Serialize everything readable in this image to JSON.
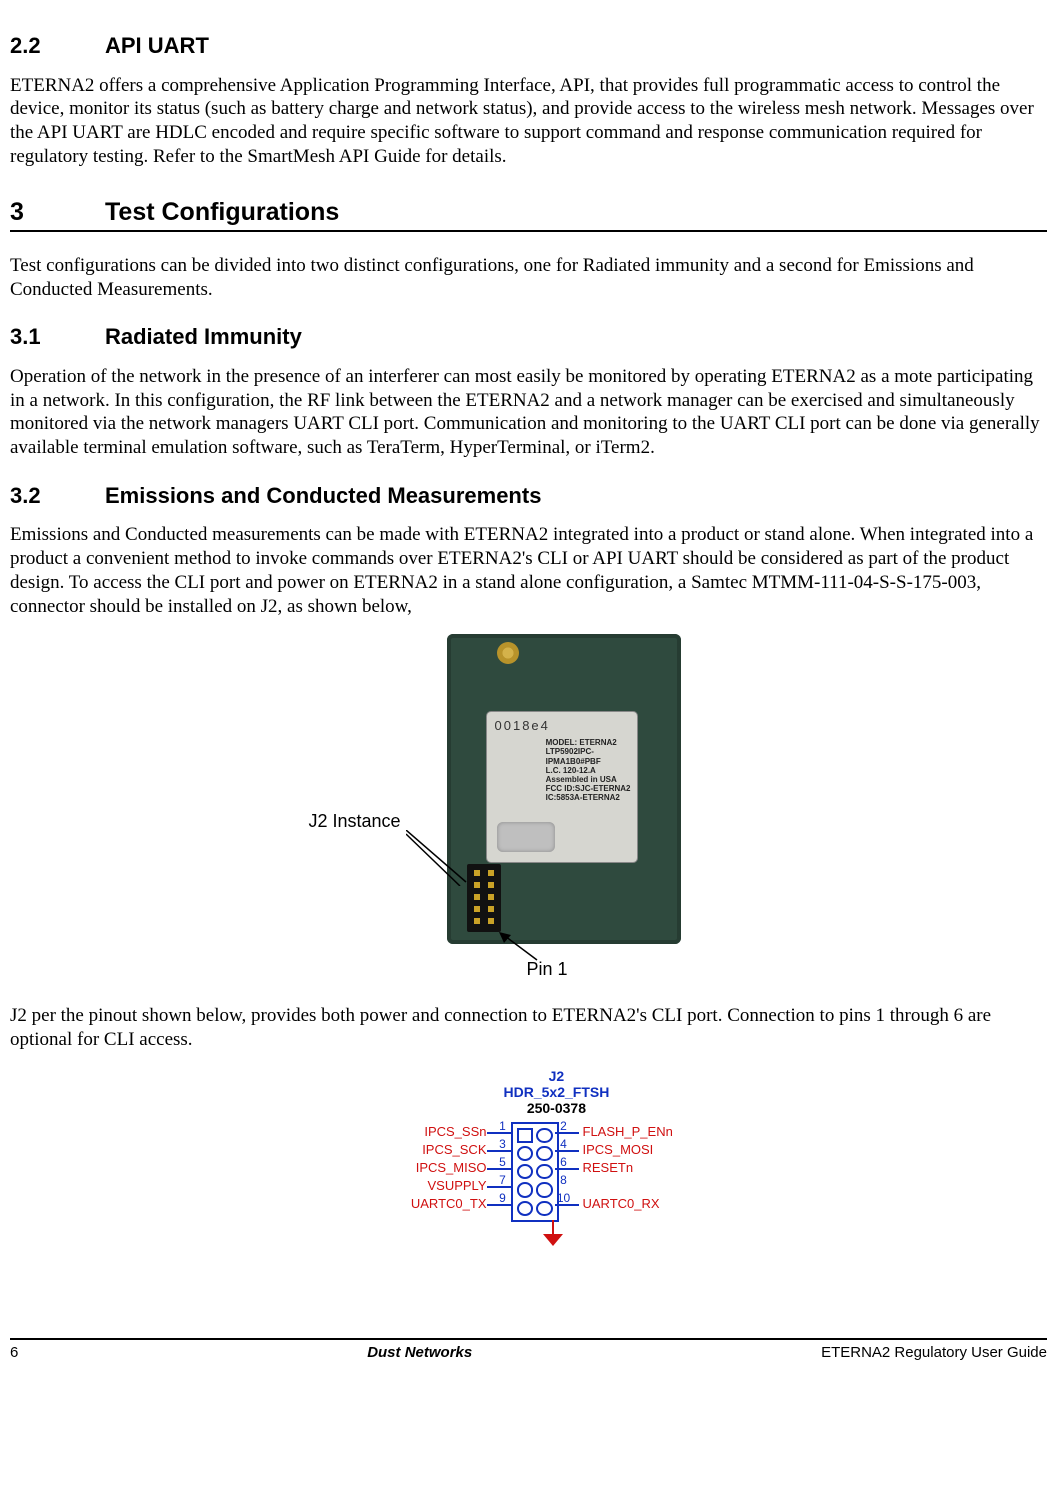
{
  "s22": {
    "num": "2.2",
    "title": "API UART",
    "p1": "ETERNA2 offers a comprehensive Application Programming Interface, API, that provides full programmatic access to control the device, monitor its status (such as battery charge and network status), and provide access to the wireless mesh network. Messages over the API UART are HDLC encoded and require specific software to support command and response communication required for regulatory testing.  Refer to the SmartMesh API Guide for details."
  },
  "s3": {
    "num": "3",
    "title": "Test Configurations",
    "p1": "Test configurations can be divided into two distinct configurations, one for Radiated immunity and a second for Emissions and Conducted Measurements."
  },
  "s31": {
    "num": "3.1",
    "title": "Radiated Immunity",
    "p1": "Operation of the network in the presence of an interferer can most easily be monitored by operating ETERNA2 as a mote participating in a network.  In this configuration, the RF link between the ETERNA2 and a network manager can be exercised and simultaneously monitored via the network managers UART CLI port.  Communication and monitoring to the UART CLI port can be done via generally available terminal emulation software, such as TeraTerm, HyperTerminal, or iTerm2."
  },
  "s32": {
    "num": "3.2",
    "title": "Emissions and Conducted Measurements",
    "p1": "Emissions and Conducted measurements can be made with ETERNA2 integrated into a product or stand alone.  When integrated into a product a convenient method to invoke commands over ETERNA2's CLI or API UART should be considered as part of the product design.  To access the CLI port and power on ETERNA2 in a stand alone configuration, a Samtec MTMM-111-04-S-S-175-003, connector should be installed on J2, as shown below,",
    "p2": "J2 per the pinout shown below, provides both power and connection to ETERNA2's CLI port.  Connection to pins 1 through 6 are optional for CLI access."
  },
  "fig1": {
    "callout_j2": "J2 Instance",
    "callout_pin1": "Pin 1",
    "mac": "0018e4",
    "label_lines": "MODEL: ETERNA2\nLTP5902IPC-\nIPMA1B0#PBF\nL.C. 120-12.A\nAssembled in USA\nFCC ID:SJC-ETERNA2\nIC:5853A-ETERNA2"
  },
  "fig2": {
    "ref": "J2",
    "part": "HDR_5x2_FTSH",
    "pn": "250-0378",
    "left": [
      "IPCS_SSn",
      "IPCS_SCK",
      "IPCS_MISO",
      "VSUPPLY",
      "UARTC0_TX"
    ],
    "left_nums": [
      "1",
      "3",
      "5",
      "7",
      "9"
    ],
    "right": [
      "FLASH_P_ENn",
      "IPCS_MOSI",
      "RESETn",
      "",
      "UARTC0_RX"
    ],
    "right_nums": [
      "2",
      "4",
      "6",
      "8",
      "10"
    ]
  },
  "footer": {
    "page": "6",
    "center": "Dust Networks",
    "right": "ETERNA2 Regulatory User Guide"
  }
}
